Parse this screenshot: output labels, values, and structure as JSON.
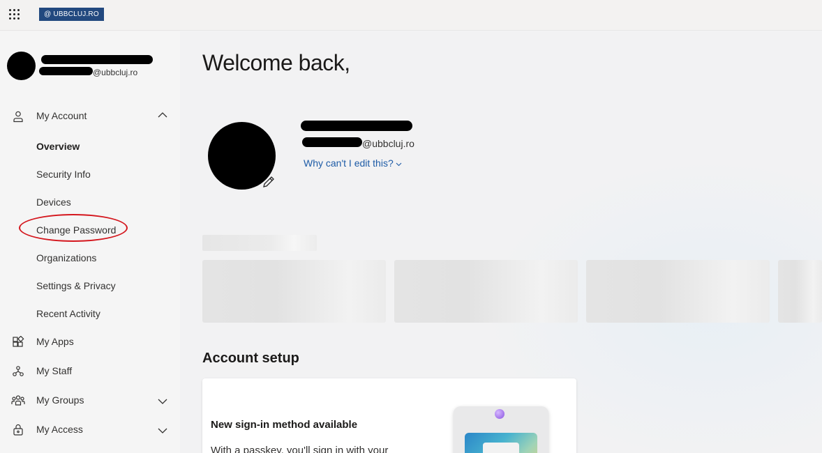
{
  "topbar": {
    "waffle_icon": "app-launcher-icon",
    "brand": "@ UBBCLUJ.RO",
    "brand_color": "#22497f"
  },
  "sidebar": {
    "user_email_domain": "@ubbcluj.ro",
    "my_account": {
      "label": "My Account",
      "icon": "person-icon",
      "expanded": true,
      "items": [
        {
          "label": "Overview",
          "active": true
        },
        {
          "label": "Security Info"
        },
        {
          "label": "Devices"
        },
        {
          "label": "Change Password"
        },
        {
          "label": "Organizations"
        },
        {
          "label": "Settings & Privacy"
        },
        {
          "label": "Recent Activity"
        }
      ]
    },
    "sections": [
      {
        "label": "My Apps",
        "icon": "apps-icon"
      },
      {
        "label": "My Staff",
        "icon": "staff-icon"
      },
      {
        "label": "My Groups",
        "icon": "groups-icon"
      },
      {
        "label": "My Access",
        "icon": "access-icon"
      }
    ]
  },
  "main": {
    "welcome": "Welcome back,",
    "profile": {
      "email_domain": "@ubbcluj.ro",
      "why_link": "Why can't I edit this?"
    },
    "account_setup": {
      "title": "Account setup",
      "card": {
        "heading": "New sign-in method available",
        "body": "With a passkey, you'll sign in with your"
      }
    }
  },
  "annotation": {
    "color": "#d4161d"
  }
}
